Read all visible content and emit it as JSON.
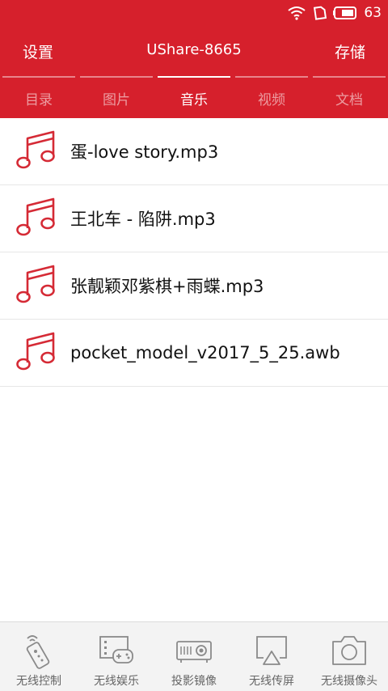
{
  "status_bar": {
    "battery_level": "63"
  },
  "header": {
    "left_label": "设置",
    "title": "UShare-8665",
    "right_label": "存储"
  },
  "tabs": [
    {
      "label": "目录",
      "active": false
    },
    {
      "label": "图片",
      "active": false
    },
    {
      "label": "音乐",
      "active": true
    },
    {
      "label": "视频",
      "active": false
    },
    {
      "label": "文档",
      "active": false
    }
  ],
  "files": [
    {
      "name": "蛋-love story.mp3",
      "icon": "music-note-icon"
    },
    {
      "name": "王北车 - 陷阱.mp3",
      "icon": "music-note-icon"
    },
    {
      "name": "张靓颖邓紫棋+雨蝶.mp3",
      "icon": "music-note-icon"
    },
    {
      "name": "pocket_model_v2017_5_25.awb",
      "icon": "music-note-icon"
    }
  ],
  "bottom_nav": [
    {
      "label": "无线控制",
      "icon": "remote-control-icon"
    },
    {
      "label": "无线娱乐",
      "icon": "gamepad-icon"
    },
    {
      "label": "投影镜像",
      "icon": "projector-icon"
    },
    {
      "label": "无线传屏",
      "icon": "airplay-icon"
    },
    {
      "label": "无线摄像头",
      "icon": "camera-icon"
    }
  ],
  "colors": {
    "brand": "#d6202c",
    "icon_red": "#d52a35",
    "icon_gray": "#8a8a8a"
  }
}
